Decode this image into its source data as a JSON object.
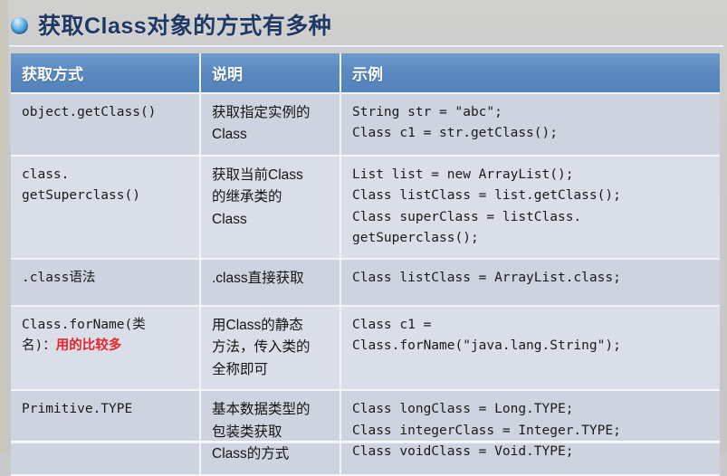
{
  "slide": {
    "title": "获取Class对象的方式有多种",
    "bullet_icon": "blue-sphere-bullet-icon",
    "background_color": "#c9c9c9",
    "title_color": "#1f3864",
    "accent_color": "#5b89bf",
    "highlight_color": "#e8252b"
  },
  "table": {
    "headers": {
      "method": "获取方式",
      "description": "说明",
      "example": "示例"
    },
    "rows": [
      {
        "method": "object.getClass()",
        "method_emphasis": "",
        "description": "获取指定实例的\nClass",
        "example": "String str = \"abc\";\nClass c1 = str.getClass();"
      },
      {
        "method": "class.\ngetSuperclass()",
        "method_emphasis": "",
        "description": "获取当前Class\n的继承类的\nClass",
        "example": "List list = new ArrayList();\nClass listClass = list.getClass();\nClass superClass = listClass.\ngetSuperclass();"
      },
      {
        "method": ".class语法",
        "method_emphasis": "",
        "description": ".class直接获取",
        "example": "Class listClass = ArrayList.class;"
      },
      {
        "method": "Class.forName(类\n名)：",
        "method_emphasis": "用的比较多",
        "description": "用Class的静态\n方法，传入类的\n全称即可",
        "example": "Class c1 =\nClass.forName(\"java.lang.String\");"
      },
      {
        "method": "Primitive.TYPE",
        "method_emphasis": "",
        "description": "基本数据类型的\n包装类获取\nClass的方式",
        "example": "Class longClass = Long.TYPE;\nClass integerClass = Integer.TYPE;\nClass voidClass = Void.TYPE;"
      }
    ]
  }
}
